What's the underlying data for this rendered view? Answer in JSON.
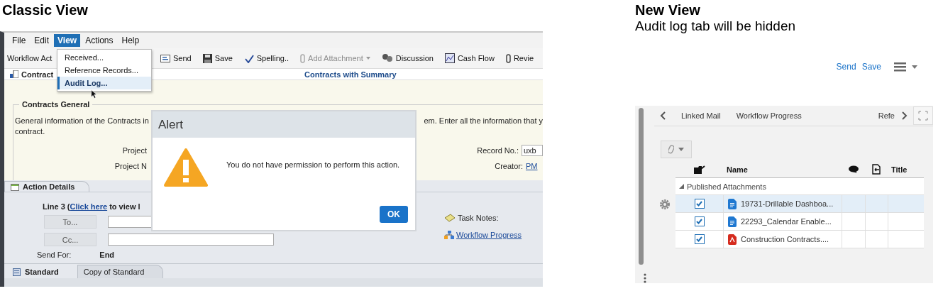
{
  "classic_view": {
    "heading": "Classic View",
    "menu_bar": [
      {
        "label": "File",
        "selected": false
      },
      {
        "label": "Edit",
        "selected": false
      },
      {
        "label": "View",
        "selected": true
      },
      {
        "label": "Actions",
        "selected": false
      },
      {
        "label": "Help",
        "selected": false
      }
    ],
    "view_menu": [
      {
        "label": "Received...",
        "selected": false
      },
      {
        "label": "Reference Records...",
        "selected": false
      },
      {
        "label": "Audit Log...",
        "selected": true
      }
    ],
    "toolbar": [
      {
        "label": "Workflow Act",
        "kind": "dropdown",
        "disabled": false
      },
      {
        "label": "Send",
        "kind": "send",
        "disabled": false
      },
      {
        "label": "Save",
        "kind": "save",
        "disabled": false
      },
      {
        "label": "Spelling..",
        "kind": "spelling",
        "disabled": false
      },
      {
        "label": "Add Attachment",
        "kind": "attachment",
        "disabled": true
      },
      {
        "label": "Discussion",
        "kind": "discussion",
        "disabled": false
      },
      {
        "label": "Cash Flow",
        "kind": "cashflow",
        "disabled": false
      },
      {
        "label": "Revie",
        "kind": "clip",
        "disabled": false
      }
    ],
    "record_tab": "Contract",
    "page_title": "Contracts with Summary",
    "section": {
      "legend": "Contracts General",
      "intro_start": "General information of the Contracts in",
      "intro_end": "em. Enter all the information that y",
      "intro_wrap": "contract.",
      "fields": [
        {
          "label": "Project",
          "right_label": "Record No.:",
          "input_value": "uxb"
        },
        {
          "label": "Project N",
          "right_label": "Creator:",
          "link_value": "PM"
        }
      ]
    },
    "action_tab": "Action Details",
    "line_text": "Line 3  (",
    "line_link": "Click here",
    "line_after": " to view l",
    "to_button": "To...",
    "cc_button": "Cc...",
    "send_for_label": "Send For:",
    "send_for_value": "End",
    "task_notes": "Task Notes:",
    "workflow_link": "Workflow Progress",
    "bottom_tabs": [
      {
        "label": "Standard",
        "selected": true
      },
      {
        "label": "Copy of Standard",
        "selected": false
      }
    ],
    "alert": {
      "title": "Alert",
      "message": "You do not have permission to perform this action.",
      "button": "OK"
    }
  },
  "new_view": {
    "heading": "New View",
    "subheading": "Audit log tab will be hidden",
    "actions": [
      "Send",
      "Save"
    ],
    "tabs": [
      "Linked Mail",
      "Workflow Progress",
      "Refe"
    ],
    "columns": [
      "Name",
      "Title"
    ],
    "group": "Published Attachments",
    "rows": [
      {
        "name": "19731-Drillable Dashboa...",
        "kind": "doc",
        "checked": true,
        "selected": true
      },
      {
        "name": "22293_Calendar Enable...",
        "kind": "doc",
        "checked": true,
        "selected": false
      },
      {
        "name": "Construction Contracts....",
        "kind": "pdf",
        "checked": true,
        "selected": false
      }
    ]
  }
}
